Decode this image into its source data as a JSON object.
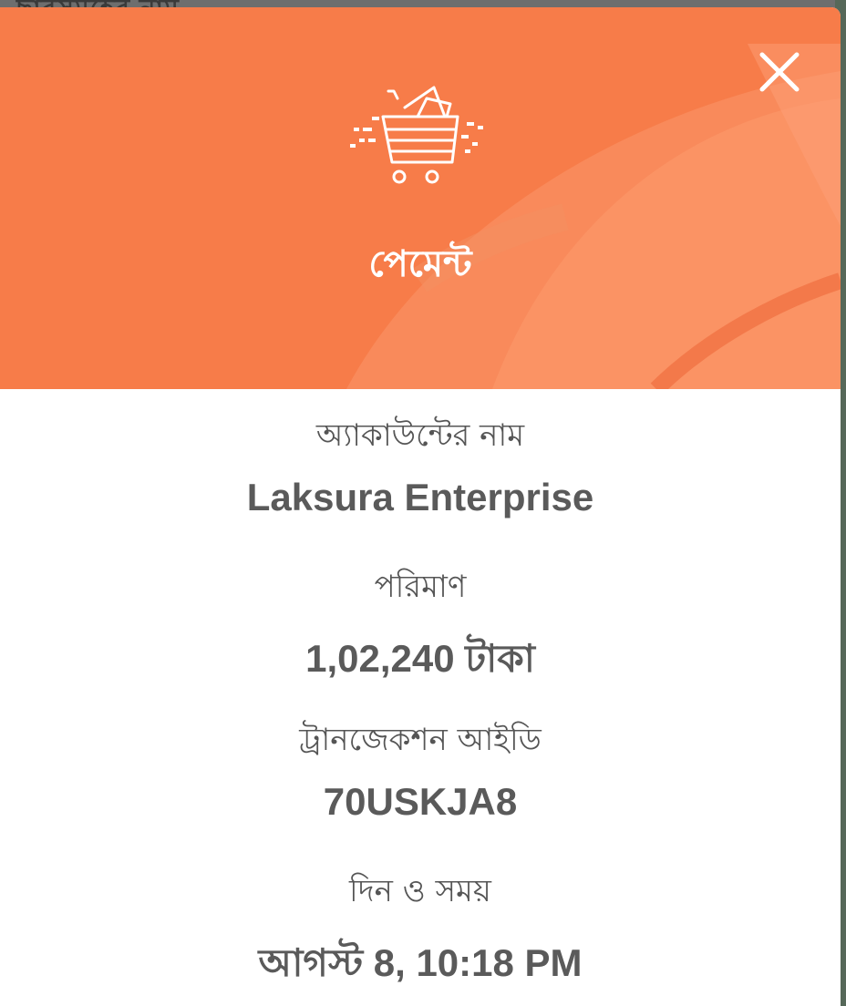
{
  "background": {
    "partial_text": "ছারসমূহের নাম"
  },
  "modal": {
    "title": "পেমেন্ট",
    "header_color": "#f77c49",
    "icon": "shopping-cart-icon",
    "close_icon": "close-icon",
    "rows": [
      {
        "label": "অ্যাকাউন্টের নাম",
        "value": "Laksura Enterprise"
      },
      {
        "label": "পরিমাণ",
        "value": "1,02,240 টাকা"
      },
      {
        "label": "ট্রানজেকশন আইডি",
        "value": "70USKJA8"
      },
      {
        "label": "দিন ও সময়",
        "value": "আগস্ট 8, 10:18 PM"
      }
    ]
  }
}
